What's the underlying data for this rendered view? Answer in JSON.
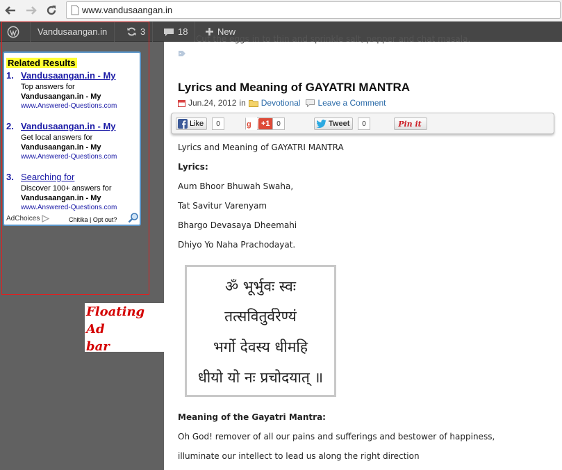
{
  "browser": {
    "url": "www.vandusaangan.in",
    "back_icon": "back-arrow-icon",
    "forward_icon": "forward-arrow-icon",
    "reload_icon": "reload-icon"
  },
  "adminbar": {
    "site_name": "Vandusaangan.in",
    "updates_count": "3",
    "comments_count": "18",
    "new_label": "New"
  },
  "ad": {
    "heading": "Related Results",
    "items": [
      {
        "num": "1.",
        "title": "Vandusaangan.in - My",
        "desc": "Top answers for",
        "brand": "Vandusaangan.in - My",
        "site": "www.Answered-Questions.com"
      },
      {
        "num": "2.",
        "title": "Vandusaangan.in - My",
        "desc": "Get local answers for",
        "brand": "Vandusaangan.in - My",
        "site": "www.Answered-Questions.com"
      },
      {
        "num": "3.",
        "title": "Searching for",
        "desc": "Discover 100+ answers for",
        "brand": "Vandusaangan.in - My",
        "site": "www.Answered-Questions.com"
      }
    ],
    "adchoices": "AdChoices",
    "chitika": "Chitika | Opt out?"
  },
  "annotation": {
    "label_line1": "Floating Ad",
    "label_line2": "bar",
    "color": "#d40000"
  },
  "post": {
    "cut_text": "Cut the eggs in to thin and sprinkle salt, pepper and chat masala.",
    "title": "Lyrics and Meaning of GAYATRI MANTRA",
    "date": "Jun.24, 2012",
    "in_label": "in",
    "category": "Devotional",
    "comment_link": "Leave a Comment",
    "share": {
      "like_label": "Like",
      "like_count": "0",
      "gplus_label": "+1",
      "gplus_count": "0",
      "tweet_label": "Tweet",
      "tweet_count": "0",
      "pin_label": "Pin it"
    },
    "intro": "Lyrics and Meaning of GAYATRI MANTRA",
    "lyrics_heading": "Lyrics:",
    "lyrics": [
      "Aum Bhoor Bhuwah Swaha,",
      "Tat Savitur Varenyam",
      "Bhargo Devasaya Dheemahi",
      "Dhiyo Yo Naha Prachodayat."
    ],
    "mantra_lines": [
      "ॐ भूर्भुवः स्वः",
      "तत्सवितुर्वरेण्यं",
      "भर्गो देवस्य धीमहि",
      "धीयो यो नः प्रचोदयात् ॥"
    ],
    "meaning_heading": "Meaning of the Gayatri Mantra:",
    "meaning": [
      "Oh God! remover of all our pains and sufferings and bestower of happiness,",
      "illuminate our intellect to lead us along the right direction"
    ]
  },
  "colors": {
    "link": "#1a1aa6",
    "highlight": "#ffff33",
    "adminbar": "#464646",
    "sidebar": "#616161"
  }
}
